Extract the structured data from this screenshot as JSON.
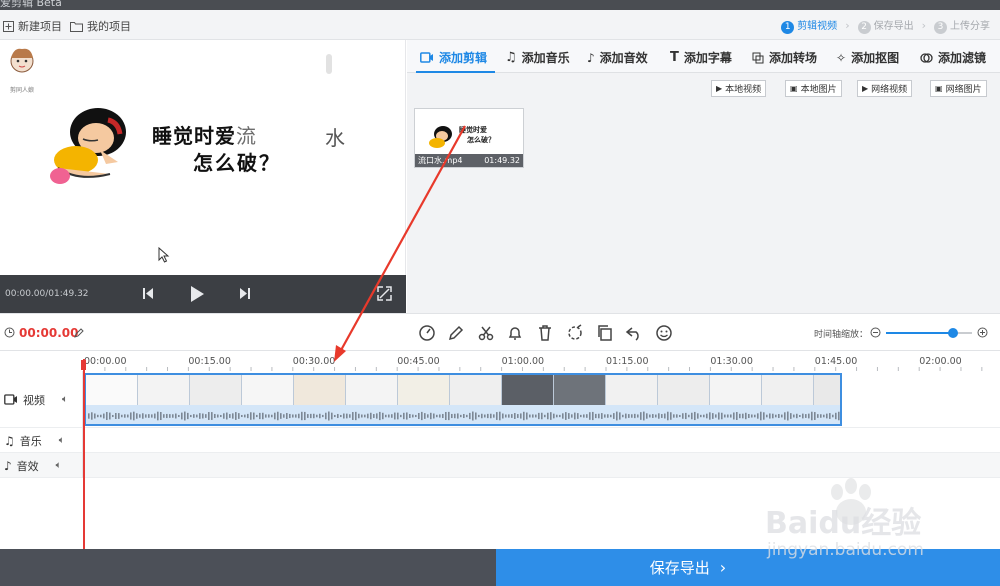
{
  "app": {
    "title": "爱剪辑 Beta"
  },
  "menu": {
    "new_project": "新建项目",
    "my_projects": "我的项目"
  },
  "steps": [
    {
      "num": "1",
      "label": "剪辑视频"
    },
    {
      "num": "2",
      "label": "保存导出"
    },
    {
      "num": "3",
      "label": "上传分享"
    }
  ],
  "preview": {
    "logo_caption": "剪同人娘",
    "line1_main": "睡觉时爱",
    "line1_fade": "流",
    "line1_right": "水",
    "line2": "怎么破？"
  },
  "player": {
    "time": "00:00.00/01:49.32"
  },
  "tabs": [
    {
      "label": "添加剪辑"
    },
    {
      "label": "添加音乐"
    },
    {
      "label": "添加音效"
    },
    {
      "label": "添加字幕"
    },
    {
      "label": "添加转场"
    },
    {
      "label": "添加抠图"
    },
    {
      "label": "添加滤镜"
    }
  ],
  "source_buttons": [
    {
      "label": "本地视频"
    },
    {
      "label": "本地图片"
    },
    {
      "label": "网络视频"
    },
    {
      "label": "网络图片"
    }
  ],
  "clip": {
    "name": "流口水.mp4",
    "duration": "01:49.32",
    "thumb_line1": "睡觉时爱",
    "thumb_line2": "怎么破？"
  },
  "toolbar": {
    "current_time": "00:00.00",
    "zoom_label": "时间轴缩放："
  },
  "timeline": {
    "ticks": [
      "00:00.00",
      "00:15.00",
      "00:30.00",
      "00:45.00",
      "01:00.00",
      "01:15.00",
      "01:30.00",
      "01:45.00",
      "02:00.00"
    ],
    "zoom_level": 0.78
  },
  "tracks": [
    {
      "label": "视频"
    },
    {
      "label": "音乐"
    },
    {
      "label": "音效"
    }
  ],
  "bottom": {
    "export_label": "保存导出"
  },
  "watermark": {
    "brand": "Baidu经验",
    "url": "jingyan.baidu.com"
  },
  "colors": {
    "accent": "#1e88e5",
    "playhead": "#e53935",
    "annotation": "#e8392b"
  }
}
